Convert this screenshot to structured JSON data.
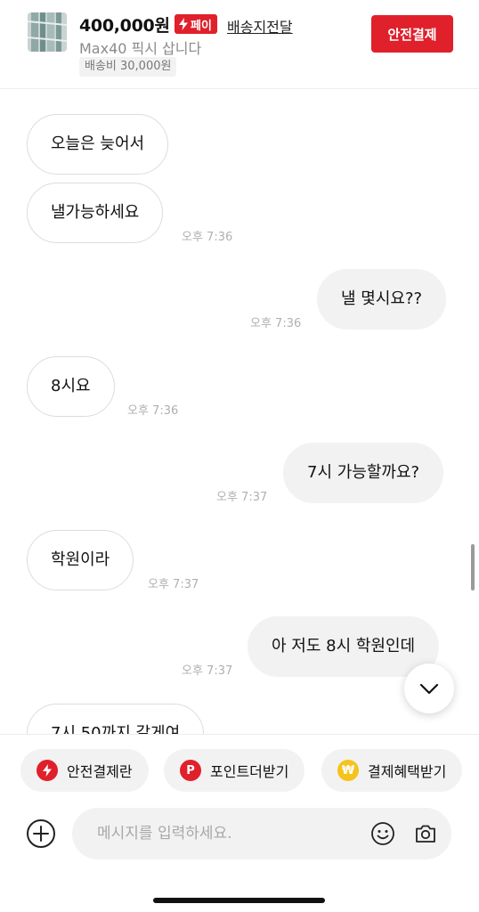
{
  "header": {
    "price": "400,000원",
    "pay_badge": "페이",
    "delivery_link": "배송지전달",
    "product_title": "Max40 픽시 삽니다",
    "shipping_fee": "배송비 30,000원",
    "pay_button": "안전결제"
  },
  "messages": [
    {
      "side": "in",
      "text": "오늘은 늦어서",
      "time": ""
    },
    {
      "side": "in",
      "text": "낼가능하세요",
      "time": "오후 7:36"
    },
    {
      "side": "out",
      "text": "낼 몇시요??",
      "time": "오후 7:36"
    },
    {
      "side": "in",
      "text": "8시요",
      "time": "오후 7:36"
    },
    {
      "side": "out",
      "text": "7시 가능할까요?",
      "time": "오후 7:37"
    },
    {
      "side": "in",
      "text": "학원이라",
      "time": "오후 7:37"
    },
    {
      "side": "out",
      "text": "아 저도 8시 학원인데",
      "time": "오후 7:37"
    },
    {
      "side": "in",
      "text": "7시 50까지 갈게여",
      "time": ""
    }
  ],
  "quick_actions": [
    {
      "label": "안전결제란",
      "icon": "lightning-icon"
    },
    {
      "label": "포인트더받기",
      "icon": "point-p-icon"
    },
    {
      "label": "결제혜택받기",
      "icon": "won-coin-icon"
    }
  ],
  "composer": {
    "placeholder": "메시지를 입력하세요.",
    "value": ""
  },
  "colors": {
    "accent_red": "#e0202b",
    "coin_yellow": "#f6c21b",
    "bubble_out": "#f2f2f2",
    "time_gray": "#b0b0b0"
  }
}
